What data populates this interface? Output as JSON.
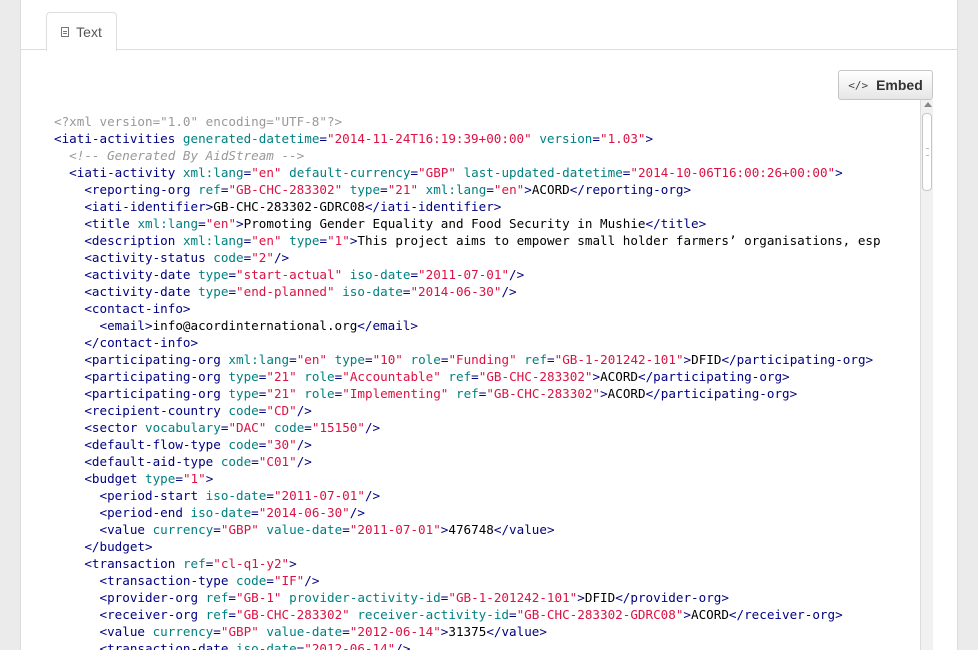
{
  "tabs": [
    {
      "label": "Text",
      "icon": "document-icon",
      "active": true
    }
  ],
  "toolbar": {
    "embed_label": "Embed",
    "embed_icon": "code-icon",
    "embed_glyph": "</>"
  },
  "code_lines": [
    [
      [
        "pi",
        "<?xml version=\"1.0\" encoding=\"UTF-8\"?>"
      ]
    ],
    [
      [
        "tag",
        "<iati-activities"
      ],
      [
        "sp",
        " "
      ],
      [
        "attr",
        "generated-datetime"
      ],
      [
        "tag",
        "="
      ],
      [
        "val",
        "\"2014-11-24T16:19:39+00:00\""
      ],
      [
        "sp",
        " "
      ],
      [
        "attr",
        "version"
      ],
      [
        "tag",
        "="
      ],
      [
        "val",
        "\"1.03\""
      ],
      [
        "tag",
        ">"
      ]
    ],
    [
      [
        "sp",
        "  "
      ],
      [
        "cm",
        "<!-- Generated By AidStream -->"
      ]
    ],
    [
      [
        "sp",
        "  "
      ],
      [
        "tag",
        "<iati-activity"
      ],
      [
        "sp",
        " "
      ],
      [
        "attr",
        "xml:lang"
      ],
      [
        "tag",
        "="
      ],
      [
        "val",
        "\"en\""
      ],
      [
        "sp",
        " "
      ],
      [
        "attr",
        "default-currency"
      ],
      [
        "tag",
        "="
      ],
      [
        "val",
        "\"GBP\""
      ],
      [
        "sp",
        " "
      ],
      [
        "attr",
        "last-updated-datetime"
      ],
      [
        "tag",
        "="
      ],
      [
        "val",
        "\"2014-10-06T16:00:26+00:00\""
      ],
      [
        "tag",
        ">"
      ]
    ],
    [
      [
        "sp",
        "    "
      ],
      [
        "tag",
        "<reporting-org"
      ],
      [
        "sp",
        " "
      ],
      [
        "attr",
        "ref"
      ],
      [
        "tag",
        "="
      ],
      [
        "val",
        "\"GB-CHC-283302\""
      ],
      [
        "sp",
        " "
      ],
      [
        "attr",
        "type"
      ],
      [
        "tag",
        "="
      ],
      [
        "val",
        "\"21\""
      ],
      [
        "sp",
        " "
      ],
      [
        "attr",
        "xml:lang"
      ],
      [
        "tag",
        "="
      ],
      [
        "val",
        "\"en\""
      ],
      [
        "tag",
        ">"
      ],
      [
        "txt",
        "ACORD"
      ],
      [
        "tag",
        "</reporting-org>"
      ]
    ],
    [
      [
        "sp",
        "    "
      ],
      [
        "tag",
        "<iati-identifier>"
      ],
      [
        "txt",
        "GB-CHC-283302-GDRC08"
      ],
      [
        "tag",
        "</iati-identifier>"
      ]
    ],
    [
      [
        "sp",
        "    "
      ],
      [
        "tag",
        "<title"
      ],
      [
        "sp",
        " "
      ],
      [
        "attr",
        "xml:lang"
      ],
      [
        "tag",
        "="
      ],
      [
        "val",
        "\"en\""
      ],
      [
        "tag",
        ">"
      ],
      [
        "txt",
        "Promoting Gender Equality and Food Security in Mushie"
      ],
      [
        "tag",
        "</title>"
      ]
    ],
    [
      [
        "sp",
        "    "
      ],
      [
        "tag",
        "<description"
      ],
      [
        "sp",
        " "
      ],
      [
        "attr",
        "xml:lang"
      ],
      [
        "tag",
        "="
      ],
      [
        "val",
        "\"en\""
      ],
      [
        "sp",
        " "
      ],
      [
        "attr",
        "type"
      ],
      [
        "tag",
        "="
      ],
      [
        "val",
        "\"1\""
      ],
      [
        "tag",
        ">"
      ],
      [
        "txt",
        "This project aims to empower small holder farmers’ organisations, esp"
      ]
    ],
    [
      [
        "sp",
        "    "
      ],
      [
        "tag",
        "<activity-status"
      ],
      [
        "sp",
        " "
      ],
      [
        "attr",
        "code"
      ],
      [
        "tag",
        "="
      ],
      [
        "val",
        "\"2\""
      ],
      [
        "tag",
        "/>"
      ]
    ],
    [
      [
        "sp",
        "    "
      ],
      [
        "tag",
        "<activity-date"
      ],
      [
        "sp",
        " "
      ],
      [
        "attr",
        "type"
      ],
      [
        "tag",
        "="
      ],
      [
        "val",
        "\"start-actual\""
      ],
      [
        "sp",
        " "
      ],
      [
        "attr",
        "iso-date"
      ],
      [
        "tag",
        "="
      ],
      [
        "val",
        "\"2011-07-01\""
      ],
      [
        "tag",
        "/>"
      ]
    ],
    [
      [
        "sp",
        "    "
      ],
      [
        "tag",
        "<activity-date"
      ],
      [
        "sp",
        " "
      ],
      [
        "attr",
        "type"
      ],
      [
        "tag",
        "="
      ],
      [
        "val",
        "\"end-planned\""
      ],
      [
        "sp",
        " "
      ],
      [
        "attr",
        "iso-date"
      ],
      [
        "tag",
        "="
      ],
      [
        "val",
        "\"2014-06-30\""
      ],
      [
        "tag",
        "/>"
      ]
    ],
    [
      [
        "sp",
        "    "
      ],
      [
        "tag",
        "<contact-info>"
      ]
    ],
    [
      [
        "sp",
        "      "
      ],
      [
        "tag",
        "<email>"
      ],
      [
        "txt",
        "info@acordinternational.org"
      ],
      [
        "tag",
        "</email>"
      ]
    ],
    [
      [
        "sp",
        "    "
      ],
      [
        "tag",
        "</contact-info>"
      ]
    ],
    [
      [
        "sp",
        "    "
      ],
      [
        "tag",
        "<participating-org"
      ],
      [
        "sp",
        " "
      ],
      [
        "attr",
        "xml:lang"
      ],
      [
        "tag",
        "="
      ],
      [
        "val",
        "\"en\""
      ],
      [
        "sp",
        " "
      ],
      [
        "attr",
        "type"
      ],
      [
        "tag",
        "="
      ],
      [
        "val",
        "\"10\""
      ],
      [
        "sp",
        " "
      ],
      [
        "attr",
        "role"
      ],
      [
        "tag",
        "="
      ],
      [
        "val",
        "\"Funding\""
      ],
      [
        "sp",
        " "
      ],
      [
        "attr",
        "ref"
      ],
      [
        "tag",
        "="
      ],
      [
        "val",
        "\"GB-1-201242-101\""
      ],
      [
        "tag",
        ">"
      ],
      [
        "txt",
        "DFID"
      ],
      [
        "tag",
        "</participating-org>"
      ]
    ],
    [
      [
        "sp",
        "    "
      ],
      [
        "tag",
        "<participating-org"
      ],
      [
        "sp",
        " "
      ],
      [
        "attr",
        "type"
      ],
      [
        "tag",
        "="
      ],
      [
        "val",
        "\"21\""
      ],
      [
        "sp",
        " "
      ],
      [
        "attr",
        "role"
      ],
      [
        "tag",
        "="
      ],
      [
        "val",
        "\"Accountable\""
      ],
      [
        "sp",
        " "
      ],
      [
        "attr",
        "ref"
      ],
      [
        "tag",
        "="
      ],
      [
        "val",
        "\"GB-CHC-283302\""
      ],
      [
        "tag",
        ">"
      ],
      [
        "txt",
        "ACORD"
      ],
      [
        "tag",
        "</participating-org>"
      ]
    ],
    [
      [
        "sp",
        "    "
      ],
      [
        "tag",
        "<participating-org"
      ],
      [
        "sp",
        " "
      ],
      [
        "attr",
        "type"
      ],
      [
        "tag",
        "="
      ],
      [
        "val",
        "\"21\""
      ],
      [
        "sp",
        " "
      ],
      [
        "attr",
        "role"
      ],
      [
        "tag",
        "="
      ],
      [
        "val",
        "\"Implementing\""
      ],
      [
        "sp",
        " "
      ],
      [
        "attr",
        "ref"
      ],
      [
        "tag",
        "="
      ],
      [
        "val",
        "\"GB-CHC-283302\""
      ],
      [
        "tag",
        ">"
      ],
      [
        "txt",
        "ACORD"
      ],
      [
        "tag",
        "</participating-org>"
      ]
    ],
    [
      [
        "sp",
        "    "
      ],
      [
        "tag",
        "<recipient-country"
      ],
      [
        "sp",
        " "
      ],
      [
        "attr",
        "code"
      ],
      [
        "tag",
        "="
      ],
      [
        "val",
        "\"CD\""
      ],
      [
        "tag",
        "/>"
      ]
    ],
    [
      [
        "sp",
        "    "
      ],
      [
        "tag",
        "<sector"
      ],
      [
        "sp",
        " "
      ],
      [
        "attr",
        "vocabulary"
      ],
      [
        "tag",
        "="
      ],
      [
        "val",
        "\"DAC\""
      ],
      [
        "sp",
        " "
      ],
      [
        "attr",
        "code"
      ],
      [
        "tag",
        "="
      ],
      [
        "val",
        "\"15150\""
      ],
      [
        "tag",
        "/>"
      ]
    ],
    [
      [
        "sp",
        "    "
      ],
      [
        "tag",
        "<default-flow-type"
      ],
      [
        "sp",
        " "
      ],
      [
        "attr",
        "code"
      ],
      [
        "tag",
        "="
      ],
      [
        "val",
        "\"30\""
      ],
      [
        "tag",
        "/>"
      ]
    ],
    [
      [
        "sp",
        "    "
      ],
      [
        "tag",
        "<default-aid-type"
      ],
      [
        "sp",
        " "
      ],
      [
        "attr",
        "code"
      ],
      [
        "tag",
        "="
      ],
      [
        "val",
        "\"C01\""
      ],
      [
        "tag",
        "/>"
      ]
    ],
    [
      [
        "sp",
        "    "
      ],
      [
        "tag",
        "<budget"
      ],
      [
        "sp",
        " "
      ],
      [
        "attr",
        "type"
      ],
      [
        "tag",
        "="
      ],
      [
        "val",
        "\"1\""
      ],
      [
        "tag",
        ">"
      ]
    ],
    [
      [
        "sp",
        "      "
      ],
      [
        "tag",
        "<period-start"
      ],
      [
        "sp",
        " "
      ],
      [
        "attr",
        "iso-date"
      ],
      [
        "tag",
        "="
      ],
      [
        "val",
        "\"2011-07-01\""
      ],
      [
        "tag",
        "/>"
      ]
    ],
    [
      [
        "sp",
        "      "
      ],
      [
        "tag",
        "<period-end"
      ],
      [
        "sp",
        " "
      ],
      [
        "attr",
        "iso-date"
      ],
      [
        "tag",
        "="
      ],
      [
        "val",
        "\"2014-06-30\""
      ],
      [
        "tag",
        "/>"
      ]
    ],
    [
      [
        "sp",
        "      "
      ],
      [
        "tag",
        "<value"
      ],
      [
        "sp",
        " "
      ],
      [
        "attr",
        "currency"
      ],
      [
        "tag",
        "="
      ],
      [
        "val",
        "\"GBP\""
      ],
      [
        "sp",
        " "
      ],
      [
        "attr",
        "value-date"
      ],
      [
        "tag",
        "="
      ],
      [
        "val",
        "\"2011-07-01\""
      ],
      [
        "tag",
        ">"
      ],
      [
        "txt",
        "476748"
      ],
      [
        "tag",
        "</value>"
      ]
    ],
    [
      [
        "sp",
        "    "
      ],
      [
        "tag",
        "</budget>"
      ]
    ],
    [
      [
        "sp",
        "    "
      ],
      [
        "tag",
        "<transaction"
      ],
      [
        "sp",
        " "
      ],
      [
        "attr",
        "ref"
      ],
      [
        "tag",
        "="
      ],
      [
        "val",
        "\"cl-q1-y2\""
      ],
      [
        "tag",
        ">"
      ]
    ],
    [
      [
        "sp",
        "      "
      ],
      [
        "tag",
        "<transaction-type"
      ],
      [
        "sp",
        " "
      ],
      [
        "attr",
        "code"
      ],
      [
        "tag",
        "="
      ],
      [
        "val",
        "\"IF\""
      ],
      [
        "tag",
        "/>"
      ]
    ],
    [
      [
        "sp",
        "      "
      ],
      [
        "tag",
        "<provider-org"
      ],
      [
        "sp",
        " "
      ],
      [
        "attr",
        "ref"
      ],
      [
        "tag",
        "="
      ],
      [
        "val",
        "\"GB-1\""
      ],
      [
        "sp",
        " "
      ],
      [
        "attr",
        "provider-activity-id"
      ],
      [
        "tag",
        "="
      ],
      [
        "val",
        "\"GB-1-201242-101\""
      ],
      [
        "tag",
        ">"
      ],
      [
        "txt",
        "DFID"
      ],
      [
        "tag",
        "</provider-org>"
      ]
    ],
    [
      [
        "sp",
        "      "
      ],
      [
        "tag",
        "<receiver-org"
      ],
      [
        "sp",
        " "
      ],
      [
        "attr",
        "ref"
      ],
      [
        "tag",
        "="
      ],
      [
        "val",
        "\"GB-CHC-283302\""
      ],
      [
        "sp",
        " "
      ],
      [
        "attr",
        "receiver-activity-id"
      ],
      [
        "tag",
        "="
      ],
      [
        "val",
        "\"GB-CHC-283302-GDRC08\""
      ],
      [
        "tag",
        ">"
      ],
      [
        "txt",
        "ACORD"
      ],
      [
        "tag",
        "</receiver-org>"
      ]
    ],
    [
      [
        "sp",
        "      "
      ],
      [
        "tag",
        "<value"
      ],
      [
        "sp",
        " "
      ],
      [
        "attr",
        "currency"
      ],
      [
        "tag",
        "="
      ],
      [
        "val",
        "\"GBP\""
      ],
      [
        "sp",
        " "
      ],
      [
        "attr",
        "value-date"
      ],
      [
        "tag",
        "="
      ],
      [
        "val",
        "\"2012-06-14\""
      ],
      [
        "tag",
        ">"
      ],
      [
        "txt",
        "31375"
      ],
      [
        "tag",
        "</value>"
      ]
    ],
    [
      [
        "sp",
        "      "
      ],
      [
        "tag",
        "<transaction-date"
      ],
      [
        "sp",
        " "
      ],
      [
        "attr",
        "iso-date"
      ],
      [
        "tag",
        "="
      ],
      [
        "val",
        "\"2012-06-14\""
      ],
      [
        "tag",
        "/>"
      ]
    ]
  ]
}
